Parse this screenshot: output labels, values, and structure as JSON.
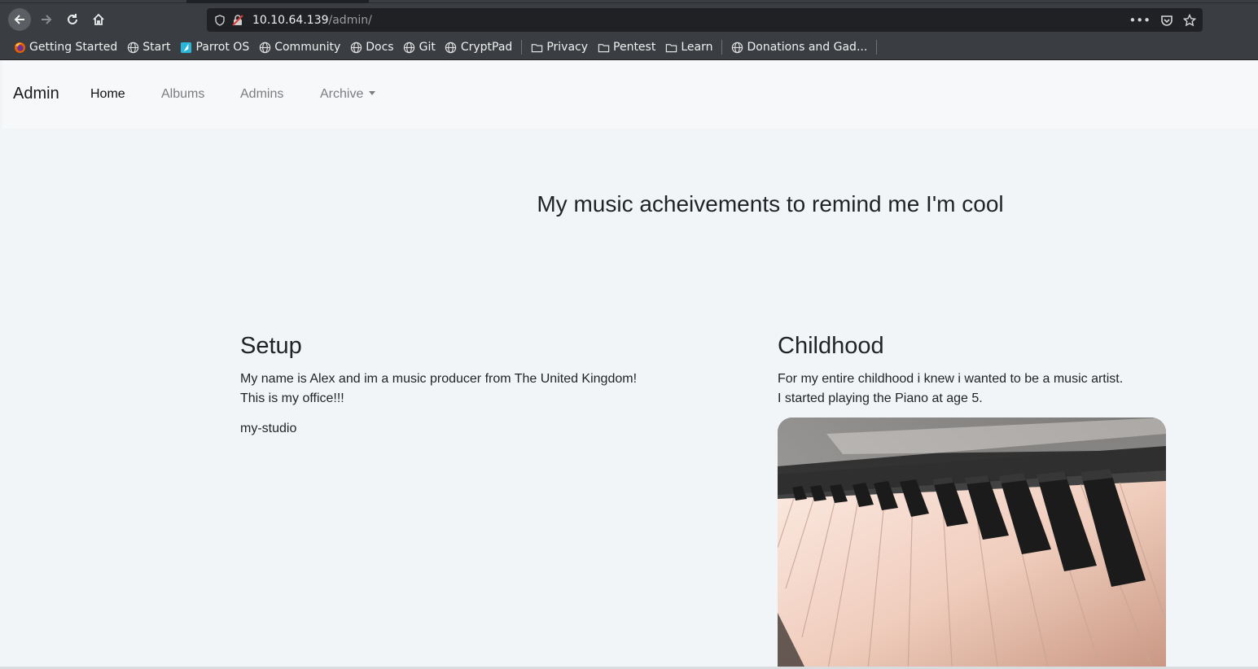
{
  "browser": {
    "url_host": "10.10.64.139",
    "url_path": "/admin/",
    "bookmarks": [
      {
        "label": "Getting Started",
        "icon": "firefox-icon"
      },
      {
        "label": "Start",
        "icon": "globe-icon"
      },
      {
        "label": "Parrot OS",
        "icon": "parrot-icon"
      },
      {
        "label": "Community",
        "icon": "globe-icon"
      },
      {
        "label": "Docs",
        "icon": "globe-icon"
      },
      {
        "label": "Git",
        "icon": "globe-icon"
      },
      {
        "label": "CryptPad",
        "icon": "globe-icon"
      },
      {
        "label": "Privacy",
        "icon": "folder-icon"
      },
      {
        "label": "Pentest",
        "icon": "folder-icon"
      },
      {
        "label": "Learn",
        "icon": "folder-icon"
      },
      {
        "label": "Donations and Gad...",
        "icon": "globe-icon"
      }
    ]
  },
  "navbar": {
    "brand": "Admin",
    "links": [
      "Home",
      "Albums",
      "Admins",
      "Archive"
    ]
  },
  "hero": {
    "title": "My music acheivements to remind me I'm cool"
  },
  "setup": {
    "heading": "Setup",
    "line1": "My name is Alex and im a music producer from The United Kingdom!",
    "line2": "This is my office!!!",
    "image_alt": "my-studio"
  },
  "childhood": {
    "heading": "Childhood",
    "line1": "For my entire childhood i knew i wanted to be a music artist.",
    "line2": "I started playing the Piano at age 5."
  },
  "colors": {
    "chrome_bg": "#3a3d41",
    "urlbar_bg": "#202124",
    "page_bg": "#f1f5f7",
    "navbar_bg": "#f7f8f9"
  }
}
